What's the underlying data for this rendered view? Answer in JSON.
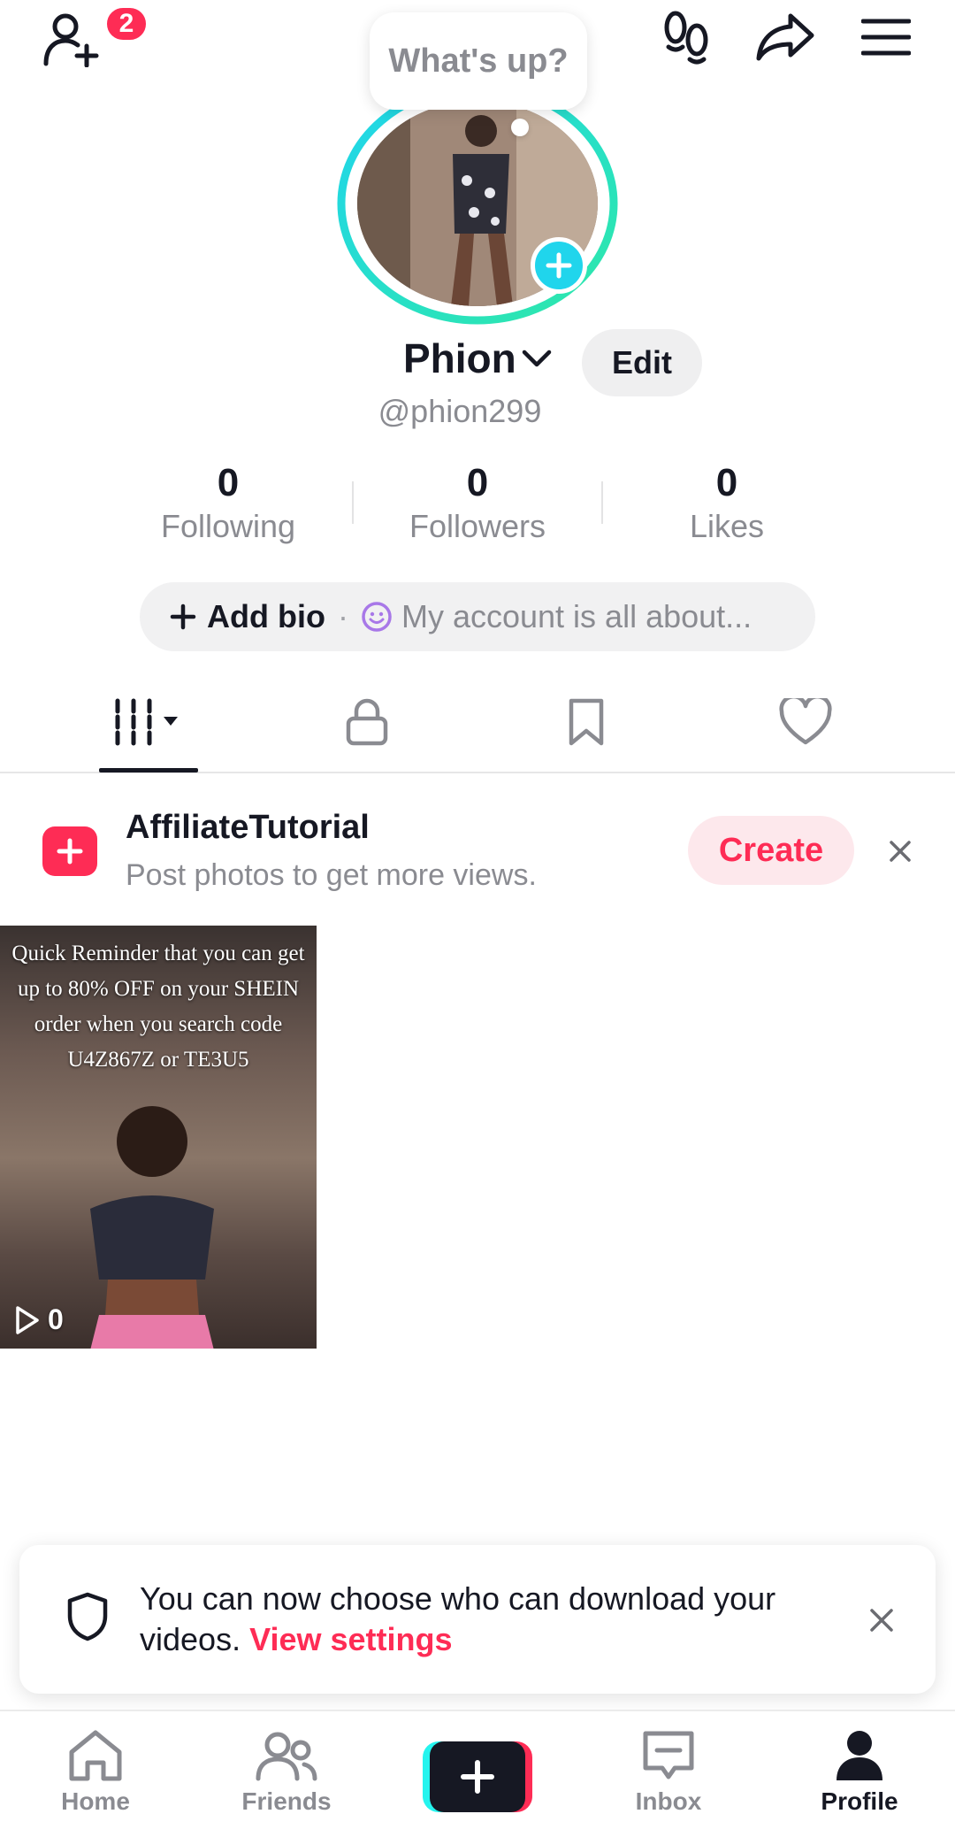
{
  "header": {
    "friend_requests_count": "2",
    "status_bubble": "What's up?"
  },
  "profile": {
    "display_name": "Phion",
    "edit_label": "Edit",
    "handle": "@phion299"
  },
  "stats": [
    {
      "value": "0",
      "label": "Following"
    },
    {
      "value": "0",
      "label": "Followers"
    },
    {
      "value": "0",
      "label": "Likes"
    }
  ],
  "bio": {
    "add_label": "Add bio",
    "separator": "·",
    "placeholder": "My account is all about..."
  },
  "tabs": [
    "videos",
    "private",
    "favorites",
    "liked"
  ],
  "promo": {
    "title": "AffiliateTutorial",
    "subtitle": "Post photos to get more views.",
    "button": "Create"
  },
  "video": {
    "caption": "Quick Reminder that you can get up to 80% OFF on your SHEIN order when you search code U4Z867Z or TE3U5",
    "views": "0"
  },
  "toast": {
    "text": "You can now choose who can download your videos.",
    "link": "View settings"
  },
  "nav": {
    "home": "Home",
    "friends": "Friends",
    "inbox": "Inbox",
    "profile": "Profile"
  },
  "colors": {
    "accent": "#fe2c55",
    "cyan": "#20d5ec",
    "text": "#161823",
    "muted": "#8a8b91"
  }
}
